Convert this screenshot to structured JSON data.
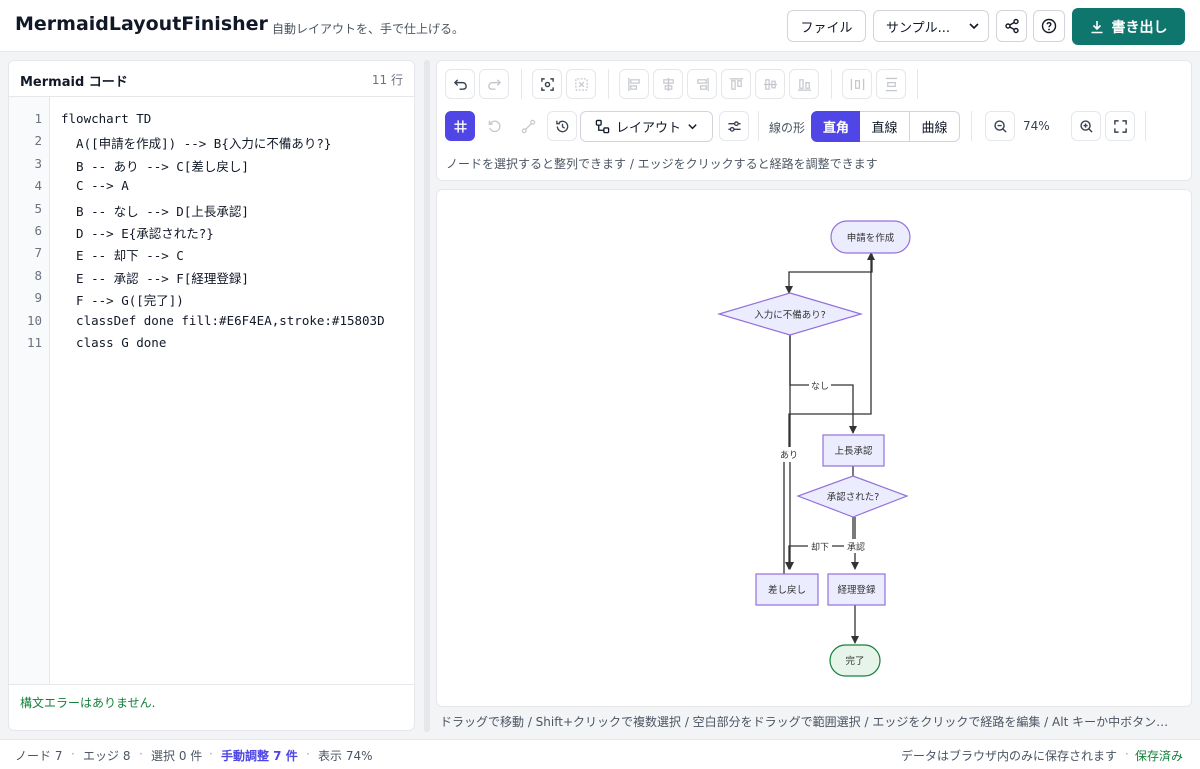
{
  "header": {
    "title": "MermaidLayoutFinisher",
    "subtitle": "自動レイアウトを、手で仕上げる。",
    "file_label": "ファイル",
    "sample_label": "サンプル...",
    "export_label": "書き出し"
  },
  "editor": {
    "title": "Mermaid コード",
    "line_count": "11 行",
    "lines": [
      {
        "n": "1",
        "code": "flowchart TD"
      },
      {
        "n": "2",
        "code": "  A([申請を作成]) --> B{入力に不備あり?}"
      },
      {
        "n": "3",
        "code": "  B -- あり --> C[差し戻し]"
      },
      {
        "n": "4",
        "code": "  C --> A"
      },
      {
        "n": "5",
        "code": "  B -- なし --> D[上長承認]"
      },
      {
        "n": "6",
        "code": "  D --> E{承認された?}"
      },
      {
        "n": "7",
        "code": "  E -- 却下 --> C"
      },
      {
        "n": "8",
        "code": "  E -- 承認 --> F[経理登録]"
      },
      {
        "n": "9",
        "code": "  F --> G([完了])"
      },
      {
        "n": "10",
        "code": "  classDef done fill:#E6F4EA,stroke:#15803D"
      },
      {
        "n": "11",
        "code": "  class G done"
      }
    ],
    "status": "構文エラーはありません."
  },
  "toolbar": {
    "layout_label": "レイアウト",
    "line_shape_label": "線の形",
    "shapes": [
      "直角",
      "直線",
      "曲線"
    ],
    "active_shape": "直角",
    "zoom": "74%",
    "hint": "ノードを選択すると整列できます / エッジをクリックすると経路を調整できます"
  },
  "diagram": {
    "nodes": {
      "A": "申請を作成",
      "B": "入力に不備あり?",
      "C": "差し戻し",
      "D": "上長承認",
      "E": "承認された?",
      "F": "経理登録",
      "G": "完了"
    },
    "edge_labels": {
      "yes": "あり",
      "no": "なし",
      "reject": "却下",
      "approve": "承認"
    }
  },
  "canvas_hint": "ドラッグで移動 / Shift+クリックで複数選択 / 空白部分をドラッグで範囲選択 / エッジをクリックで経路を編集 / Alt キーか中ボタン…",
  "status": {
    "nodes": "ノード 7",
    "edges": "エッジ 8",
    "selected": "選択 0 件",
    "manual": "手動調整 7 件",
    "zoom": "表示 74%",
    "storage": "データはブラウザ内のみに保存されます",
    "saved": "保存済み"
  },
  "colors": {
    "accent": "#4f46e5",
    "export": "#0f766e",
    "ok": "#15803d",
    "node_fill": "#ECECFF",
    "node_stroke": "#9370DB",
    "done_fill": "#E6F4EA",
    "done_stroke": "#15803D"
  }
}
